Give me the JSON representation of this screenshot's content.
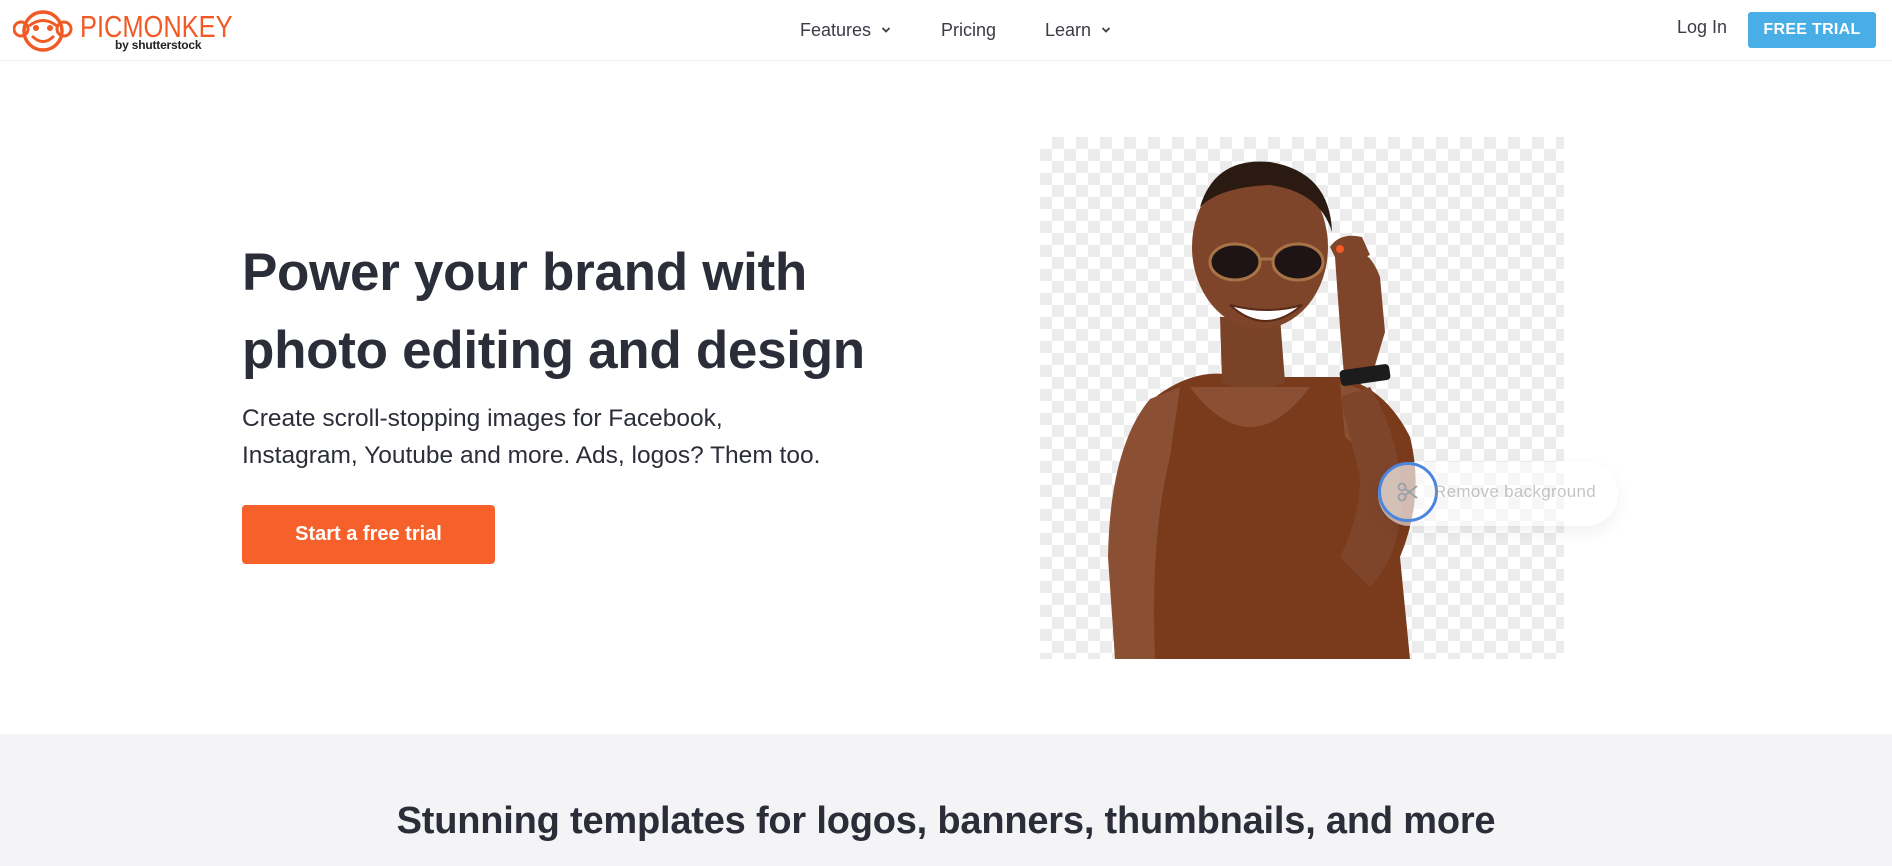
{
  "brand": {
    "name": "PICMONKEY",
    "byline": "by shutterstock",
    "accent_color": "#f15a24"
  },
  "nav": {
    "items": [
      {
        "label": "Features",
        "has_dropdown": true
      },
      {
        "label": "Pricing",
        "has_dropdown": false
      },
      {
        "label": "Learn",
        "has_dropdown": true
      }
    ],
    "login_label": "Log In",
    "trial_label": "FREE TRIAL",
    "trial_color": "#4aaee6"
  },
  "hero": {
    "title_line1": "Power your brand with",
    "title_line2": "photo editing and design",
    "subtitle_line1": "Create scroll-stopping images for Facebook,",
    "subtitle_line2": "Instagram, Youtube and more. Ads, logos? Them too.",
    "cta_label": "Start a free trial",
    "cta_color": "#f6612b",
    "tooltip_label": "Remove background",
    "tooltip_icon": "scissors-icon"
  },
  "lower": {
    "title": "Stunning templates for logos, banners, thumbnails, and more"
  }
}
